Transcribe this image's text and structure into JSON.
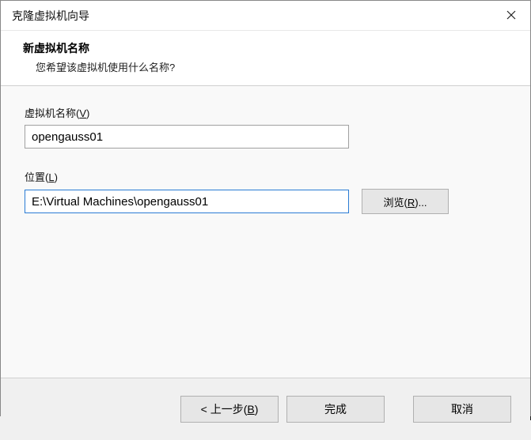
{
  "window": {
    "title": "克隆虚拟机向导"
  },
  "header": {
    "heading": "新虚拟机名称",
    "subheading": "您希望该虚拟机使用什么名称?"
  },
  "fields": {
    "name": {
      "label_prefix": "虚拟机名称(",
      "label_mnemonic": "V",
      "label_suffix": ")",
      "value": "opengauss01"
    },
    "location": {
      "label_prefix": "位置(",
      "label_mnemonic": "L",
      "label_suffix": ")",
      "value": "E:\\Virtual Machines\\opengauss01",
      "browse_prefix": "浏览(",
      "browse_mnemonic": "R",
      "browse_suffix": ")..."
    }
  },
  "footer": {
    "back_prefix": "< 上一步(",
    "back_mnemonic": "B",
    "back_suffix": ")",
    "finish": "完成",
    "cancel": "取消"
  }
}
